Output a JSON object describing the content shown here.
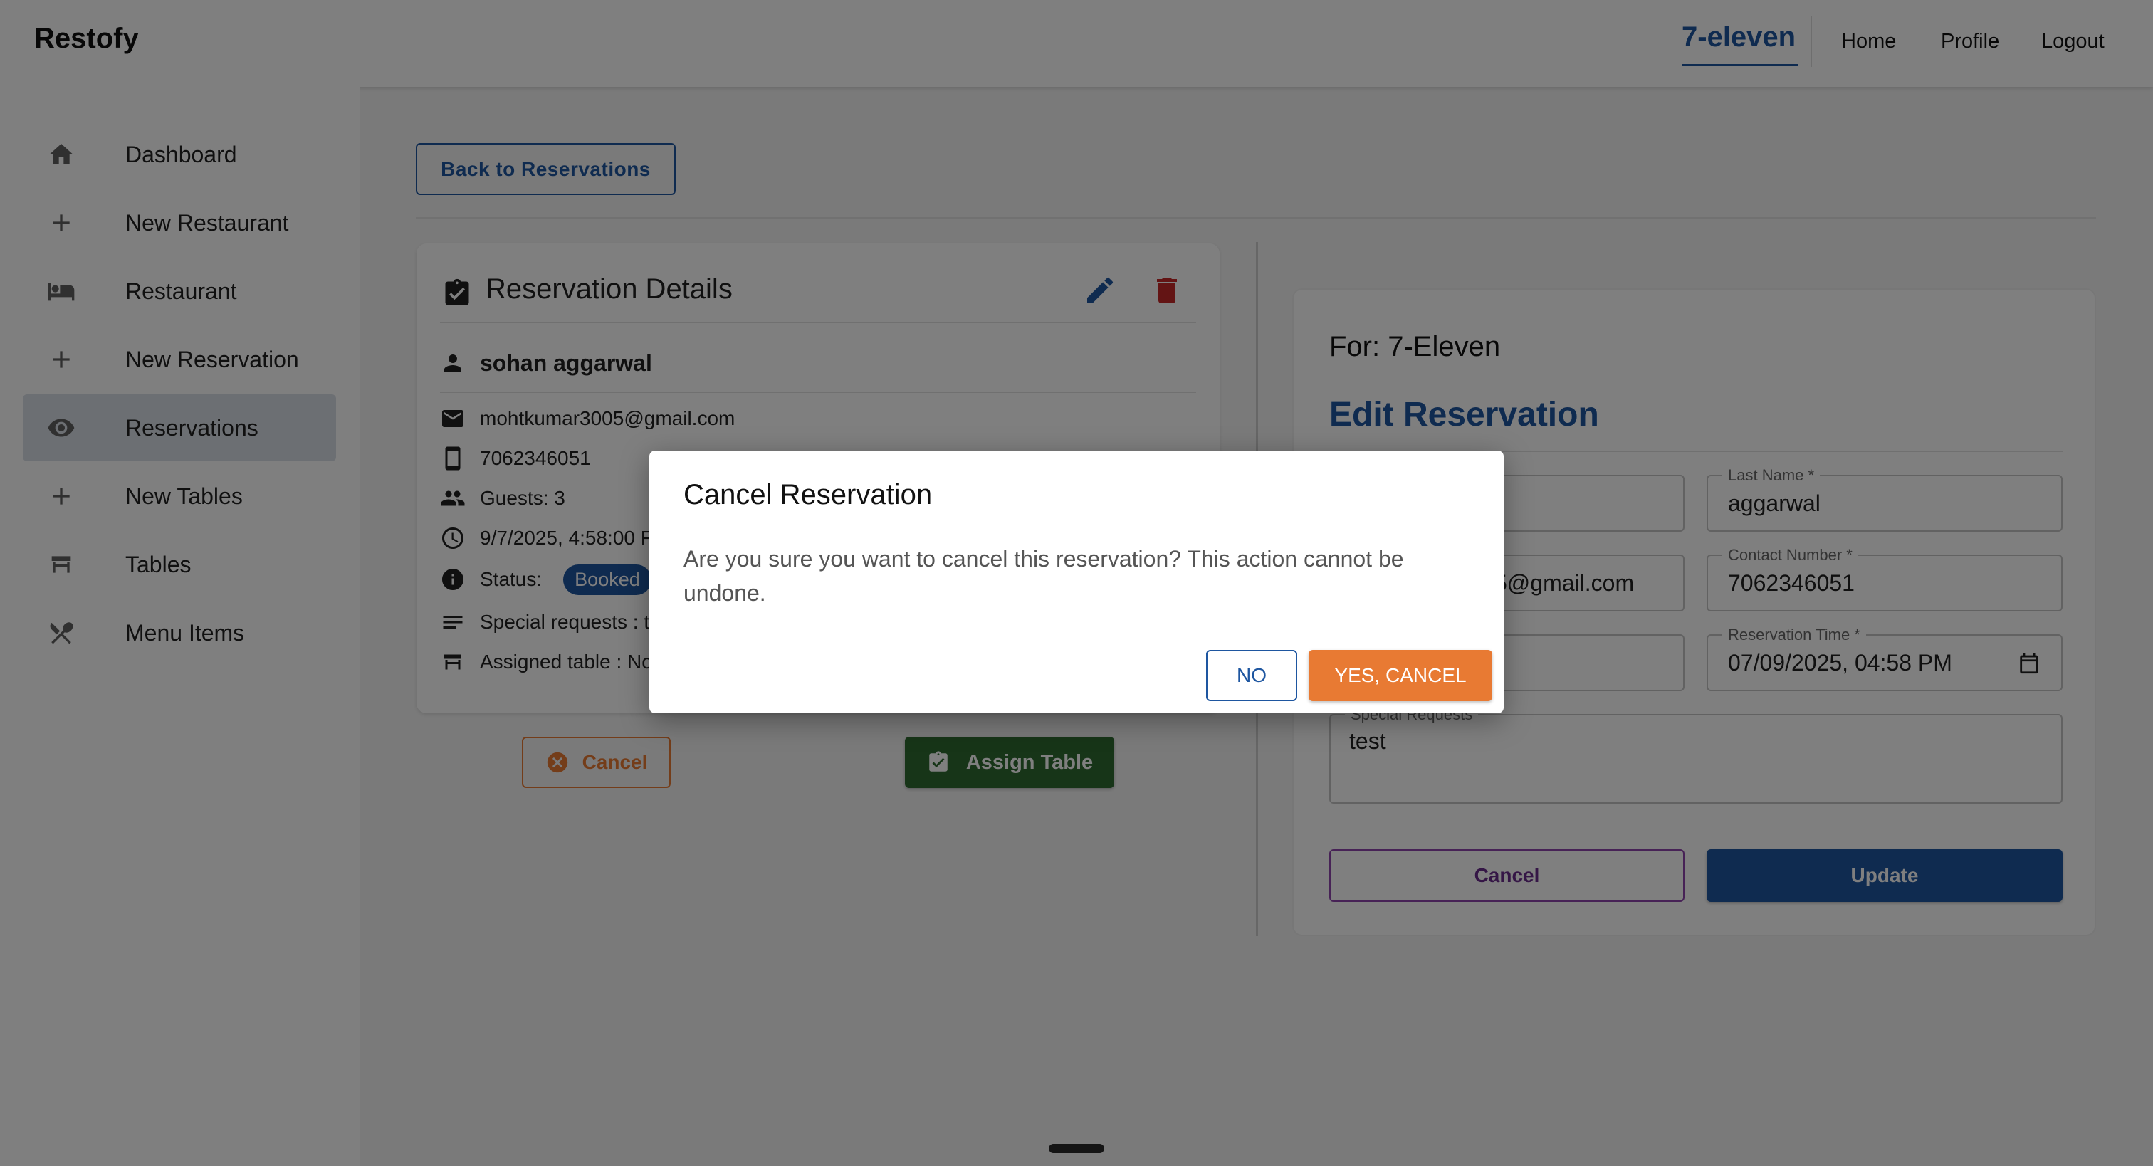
{
  "appbar": {
    "brand": "Restofy",
    "restaurant_link": "7-eleven",
    "nav": [
      "Home",
      "Profile",
      "Logout"
    ]
  },
  "sidebar": {
    "items": [
      {
        "label": "Dashboard",
        "icon": "home-icon"
      },
      {
        "label": "New Restaurant",
        "icon": "plus-icon"
      },
      {
        "label": "Restaurant",
        "icon": "bed-icon"
      },
      {
        "label": "New Reservation",
        "icon": "plus-icon"
      },
      {
        "label": "Reservations",
        "icon": "eye-icon",
        "active": true
      },
      {
        "label": "New Tables",
        "icon": "plus-icon"
      },
      {
        "label": "Tables",
        "icon": "table-icon"
      },
      {
        "label": "Menu Items",
        "icon": "utensils-icon"
      }
    ]
  },
  "main": {
    "back_label": "Back to Reservations",
    "details": {
      "title": "Reservation Details",
      "guest_name": "sohan aggarwal",
      "email": "mohtkumar3005@gmail.com",
      "phone": "7062346051",
      "guests": "Guests: 3",
      "datetime": "9/7/2025, 4:58:00 F",
      "status_label": "Status:",
      "status_value": "Booked",
      "special_requests": "Special requests : t",
      "assigned_table": "Assigned table : Nc"
    },
    "cancel_label": "Cancel",
    "assign_label": "Assign Table",
    "edit_form": {
      "for_label": "For: 7-Eleven",
      "title": "Edit Reservation",
      "last_name_label": "Last Name *",
      "last_name_value": "aggarwal",
      "email_partial": "5@gmail.com",
      "contact_label": "Contact Number *",
      "contact_value": "7062346051",
      "time_label": "Reservation Time *",
      "time_value": "07/09/2025, 04:58 PM",
      "special_label": "Special Requests",
      "special_value": "test",
      "cancel_label": "Cancel",
      "update_label": "Update"
    }
  },
  "dialog": {
    "title": "Cancel Reservation",
    "message": "Are you sure you want to cancel this reservation? This action cannot be undone.",
    "no_label": "NO",
    "yes_label": "YES, CANCEL"
  },
  "colors": {
    "primary": "#1e56a0",
    "warning": "#e87a33",
    "success": "#2e6b31",
    "danger": "#c62828"
  }
}
